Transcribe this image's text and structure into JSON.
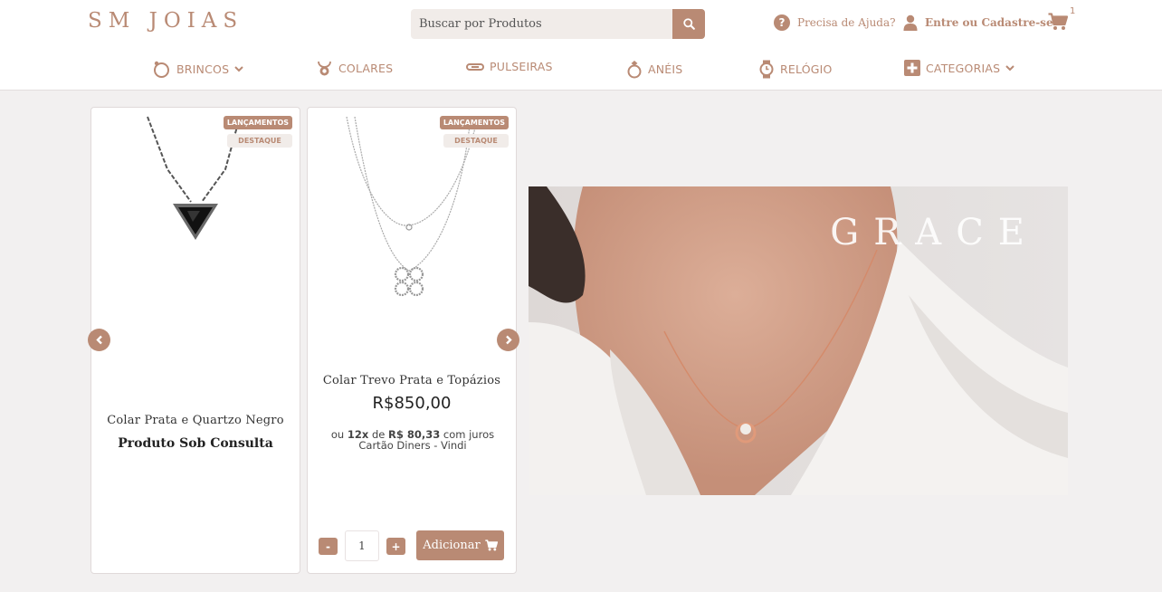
{
  "header": {
    "logo": "SM JOIAS",
    "search_placeholder": "Buscar por Produtos",
    "help_label": "Precisa de Ajuda?",
    "account_label": "Entre ou Cadastre-se",
    "cart_count": "1"
  },
  "nav": {
    "items": [
      {
        "label": "BRINCOS",
        "icon": "earring-icon",
        "dropdown": true
      },
      {
        "label": "COLARES",
        "icon": "necklace-icon",
        "dropdown": false
      },
      {
        "label": "PULSEIRAS",
        "icon": "bracelet-icon",
        "dropdown": false
      },
      {
        "label": "ANÉIS",
        "icon": "ring-icon",
        "dropdown": false
      },
      {
        "label": "RELÓGIO",
        "icon": "watch-icon",
        "dropdown": false
      },
      {
        "label": "CATEGORIAS",
        "icon": "plus-square-icon",
        "dropdown": true
      }
    ]
  },
  "products": [
    {
      "badge_1": "LANÇAMENTOS",
      "badge_2": "DESTAQUE",
      "name": "Colar Prata e Quartzo Negro",
      "status": "Produto Sob Consulta"
    },
    {
      "badge_1": "LANÇAMENTOS",
      "badge_2": "DESTAQUE",
      "name": "Colar Trevo Prata e Topázios",
      "price": "R$850,00",
      "installment_prefix": "ou",
      "installment_count": "12x",
      "installment_de": "de",
      "installment_value": "R$ 80,33",
      "installment_suffix": "com juros",
      "payment_method": "Cartão Diners - Vindi",
      "qty_minus": "-",
      "quantity": "1",
      "qty_plus": "+",
      "add_label": "Adicionar"
    }
  ],
  "banner": {
    "title": "GRACE"
  },
  "colors": {
    "accent": "#b98a74",
    "background": "#f2f0f0"
  }
}
